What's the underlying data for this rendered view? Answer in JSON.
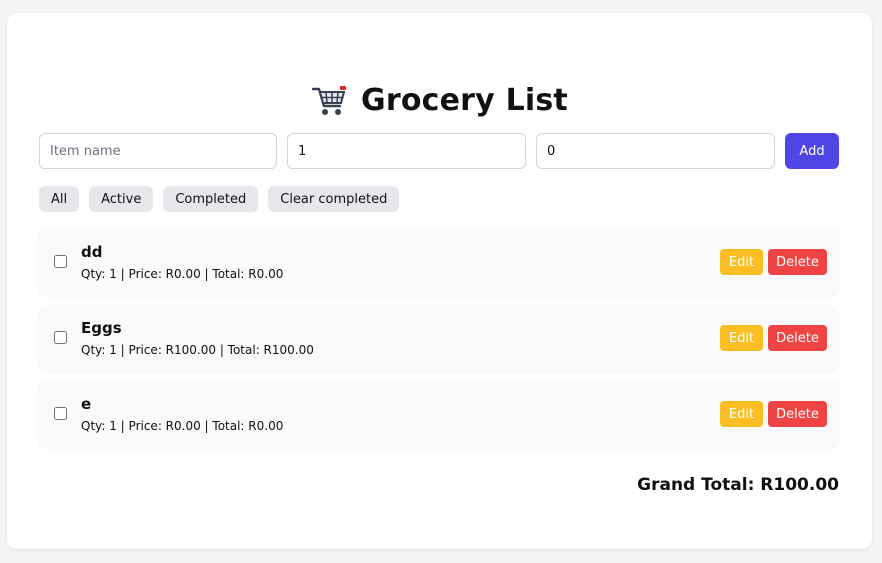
{
  "app": {
    "title": "Grocery List",
    "title_icon": "shopping-cart-icon"
  },
  "form": {
    "name_placeholder": "Item name",
    "name_value": "",
    "qty_value": "1",
    "price_value": "0",
    "add_label": "Add"
  },
  "filters": [
    {
      "label": "All"
    },
    {
      "label": "Active"
    },
    {
      "label": "Completed"
    },
    {
      "label": "Clear completed"
    }
  ],
  "items": [
    {
      "name": "dd",
      "meta": "Qty: 1 | Price: R0.00 | Total: R0.00",
      "checked": false,
      "edit_label": "Edit",
      "delete_label": "Delete"
    },
    {
      "name": "Eggs",
      "meta": "Qty: 1 | Price: R100.00 | Total: R100.00",
      "checked": false,
      "edit_label": "Edit",
      "delete_label": "Delete"
    },
    {
      "name": "e",
      "meta": "Qty: 1 | Price: R0.00 | Total: R0.00",
      "checked": false,
      "edit_label": "Edit",
      "delete_label": "Delete"
    }
  ],
  "grand_total": "Grand Total: R100.00",
  "colors": {
    "accent": "#4f46e5",
    "edit": "#fbbf24",
    "delete": "#ef4444",
    "filter_bg": "#e5e7eb"
  }
}
